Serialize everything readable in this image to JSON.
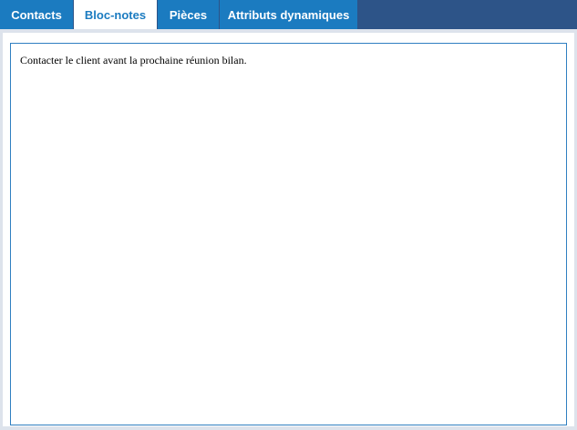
{
  "tabs": [
    {
      "label": "Contacts",
      "active": false
    },
    {
      "label": "Bloc-notes",
      "active": true
    },
    {
      "label": "Pièces",
      "active": false
    },
    {
      "label": "Attributs dynamiques",
      "active": false
    }
  ],
  "notes": {
    "value": "Contacter le client avant la prochaine réunion bilan."
  },
  "colors": {
    "tabbar_bg": "#2d5488",
    "tab_bg": "#1b7bc0",
    "tab_active_text": "#1b7bc0",
    "panel_bg": "#dde3ec",
    "field_border": "#2f7fc1"
  }
}
